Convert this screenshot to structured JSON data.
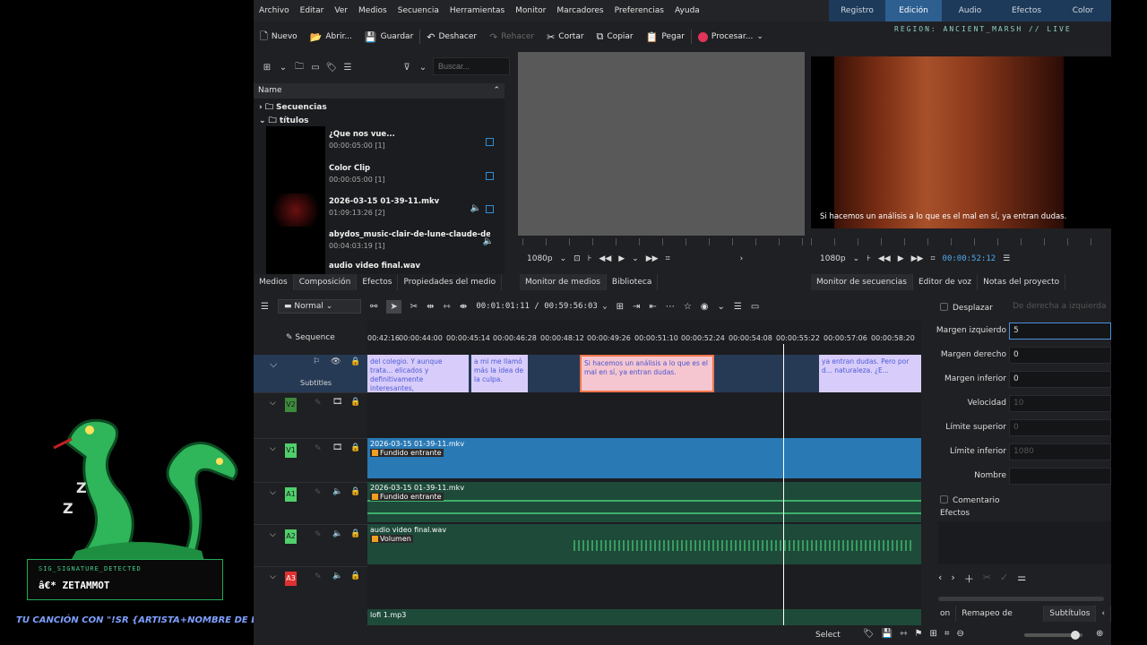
{
  "menu": [
    "Archivo",
    "Editar",
    "Ver",
    "Medios",
    "Secuencia",
    "Herramientas",
    "Monitor",
    "Marcadores",
    "Preferencias",
    "Ayuda"
  ],
  "modes": [
    "Registro",
    "Edición",
    "Audio",
    "Efectos",
    "Color"
  ],
  "region_text": "REGION: ANCIENT_MARSH // LIVE",
  "toolbar": {
    "new": "Nuevo",
    "open": "Abrir...",
    "save": "Guardar",
    "undo": "Deshacer",
    "redo": "Rehacer",
    "cut": "Cortar",
    "copy": "Copiar",
    "paste": "Pegar",
    "render": "Procesar..."
  },
  "bin": {
    "search_placeholder": "Buscar...",
    "header": "Name",
    "folders": [
      "Secuencias",
      "títulos"
    ],
    "clips": [
      {
        "name": "¿Que nos vue...",
        "duration": "00:00:05:00 [1]"
      },
      {
        "name": "Color Clip",
        "duration": "00:00:05:00 [1]"
      },
      {
        "name": "2026-03-15 01-39-11.mkv",
        "duration": "01:09:13:26 [2]"
      },
      {
        "name": "abydos_music-clair-de-lune-claude-debussy-m",
        "duration": "00:04:03:19 [1]"
      },
      {
        "name": "audio video final.wav",
        "duration": ""
      }
    ]
  },
  "left_tabs": [
    "Medios",
    "Composición",
    "Efectos",
    "Propiedades del medio"
  ],
  "clip_monitor": {
    "res": "1080p",
    "tabs": [
      "Monitor de medios",
      "Biblioteca"
    ]
  },
  "project_monitor": {
    "res": "1080p",
    "timecode": "00:00:52:12",
    "subtitle": "Si hacemos un análisis a lo que es el mal en sí, ya entran dudas.",
    "tabs": [
      "Monitor de secuencias",
      "Editor de voz",
      "Notas del proyecto"
    ]
  },
  "timeline": {
    "mode": "Normal",
    "timecode": "00:01:01:11",
    "duration": "00:59:56:03",
    "sequence_label": "Sequence",
    "subtitles_label": "Subtitles",
    "ruler": [
      "00:42:16",
      "00:00:44:00",
      "00:00:45:14",
      "00:00:46:28",
      "00:00:48:12",
      "00:00:49:26",
      "00:00:51:10",
      "00:00:52:24",
      "00:00:54:08",
      "00:00:55:22",
      "00:00:57:06",
      "00:00:58:20"
    ],
    "subs": [
      "del colegio. Y aunque trata... elicados y definitivamente interesantes,",
      "a mi me llamó más la idea de la culpa.",
      "Si hacemos un análisis a lo que es el mal en sí, ya entran dudas.",
      "ya entran dudas. Pero por d... naturaleza. ¿E..."
    ],
    "tracks": [
      "V2",
      "V1",
      "A1",
      "A2",
      "A3"
    ],
    "clips": {
      "v1_name": "2026-03-15 01-39-11.mkv",
      "v1_effect": "Fundido entrante",
      "a1_name": "2026-03-15 01-39-11.mkv",
      "a1_effect": "Fundido entrante",
      "a2_name": "audio video final.wav",
      "a2_effect": "Volumen",
      "a4_name": "lofi 1.mp3"
    }
  },
  "props": {
    "scroll": "Desplazar",
    "direction": "De derecha a izquierda",
    "left_margin_label": "Margen izquierdo",
    "left_margin": "5",
    "right_margin_label": "Margen derecho",
    "right_margin": "0",
    "bottom_margin_label": "Margen inferior",
    "bottom_margin": "0",
    "speed_label": "Velocidad",
    "speed": "10",
    "upper_label": "Límite superior",
    "upper": "0",
    "lower_label": "Límite inferior",
    "lower": "1080",
    "name_label": "Nombre",
    "name": "",
    "comment": "Comentario",
    "effects": "Efectos",
    "bottom_tabs": [
      "on",
      "Remapeo de tiempo",
      "Subtítulos"
    ]
  },
  "status": {
    "select": "Select"
  },
  "overlay": {
    "small": "SIG_SIGNATURE_DETECTED",
    "big": "â€* ZETAMMOT",
    "bottom": "TU CANCIÓN CON \"!SR {ARTISTA+NOMBRE DE LA CANCIÓN}\""
  }
}
